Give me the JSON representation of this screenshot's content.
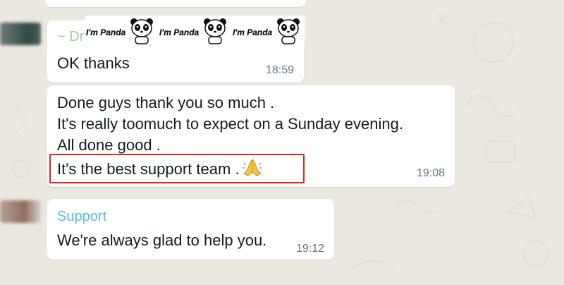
{
  "messages": [
    {
      "sender": "~ Dr",
      "lines": [
        "OK thanks"
      ],
      "time": "18:59"
    },
    {
      "sender": "",
      "lines": [
        "Done guys thank you so much .",
        "It's really toomuch to expect on a Sunday evening.",
        "All done good .",
        "It's the best support team ."
      ],
      "time": "19:08",
      "emoji": "🙏"
    },
    {
      "sender": "Support",
      "lines": [
        "We're always glad to help you."
      ],
      "time": "19:12"
    }
  ],
  "sticker_text": "I'm Panda",
  "colors": {
    "chat_background": "#ebe7e1",
    "bubble": "#ffffff",
    "sender_support": "#53bdeb",
    "highlight_border": "#e0261e",
    "timestamp": "#667781"
  }
}
